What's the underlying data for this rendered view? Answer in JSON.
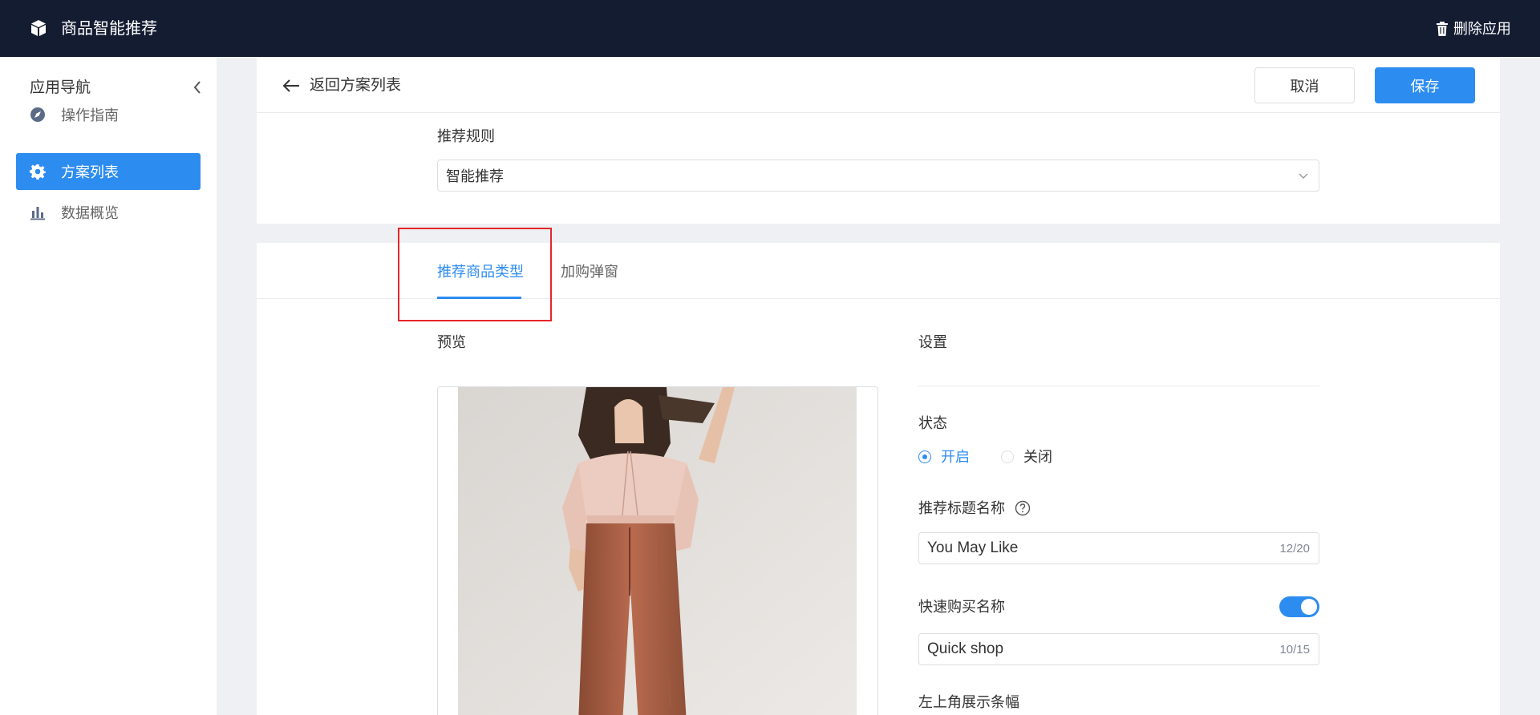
{
  "topbar": {
    "app_title": "商品智能推荐",
    "delete_label": "删除应用",
    "logo_icon": "box-icon",
    "delete_icon": "trash-icon"
  },
  "sidebar": {
    "heading": "应用导航",
    "items": [
      {
        "label": "操作指南",
        "icon": "compass-icon",
        "active": false
      },
      {
        "label": "方案列表",
        "icon": "gear-icon",
        "active": true
      },
      {
        "label": "数据概览",
        "icon": "bar-chart-icon",
        "active": false
      }
    ]
  },
  "header": {
    "back_label": "返回方案列表",
    "cancel_label": "取消",
    "save_label": "保存"
  },
  "rule": {
    "label": "推荐规则",
    "selected": "智能推荐"
  },
  "tabs": [
    {
      "label": "推荐商品类型",
      "active": true
    },
    {
      "label": "加购弹窗",
      "active": false
    }
  ],
  "preview": {
    "label": "预览"
  },
  "settings": {
    "label": "设置",
    "state_label": "状态",
    "state_on": "开启",
    "state_off": "关闭",
    "state_value": "开启",
    "rec_title_label": "推荐标题名称",
    "rec_title_value": "You May Like",
    "rec_title_count": "12/20",
    "quick_buy_label": "快速购买名称",
    "quick_buy_enabled": true,
    "quick_buy_value": "Quick shop",
    "quick_buy_count": "10/15",
    "banner_label": "左上角展示条幅"
  },
  "colors": {
    "topbar_bg": "#141c32",
    "accent": "#2d8cf0",
    "highlight": "#e5262a"
  }
}
